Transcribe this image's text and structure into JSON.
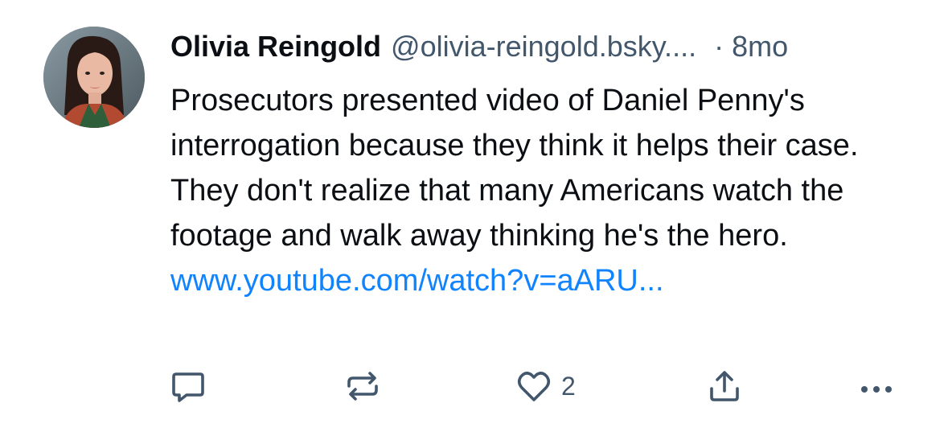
{
  "post": {
    "author": {
      "name": "Olivia Reingold",
      "handle": "@olivia-reingold.bsky....",
      "avatar_alt": "avatar"
    },
    "separator": "·",
    "timestamp": "8mo",
    "text": "Prosecutors presented video of Daniel Penny's interrogation because they think it helps their case. They don't realize that many Americans watch the footage and walk away thinking he's the hero.",
    "link": "www.youtube.com/watch?v=aARU...",
    "actions": {
      "reply_icon": "reply-icon",
      "repost_icon": "repost-icon",
      "like_icon": "heart-icon",
      "like_count": "2",
      "share_icon": "share-icon",
      "more_icon": "more-icon"
    },
    "colors": {
      "text": "#0b0f14",
      "secondary": "#42576c",
      "link": "#1083fe"
    }
  }
}
